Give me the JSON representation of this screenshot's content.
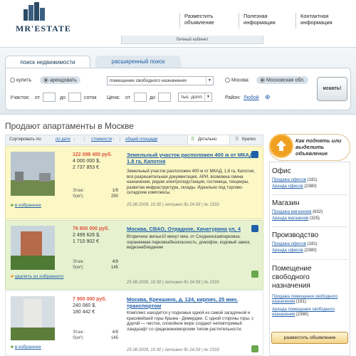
{
  "header": {
    "logo_text": "MR'ESTATE",
    "links": [
      {
        "label": "Разместить объявление"
      },
      {
        "label": "Полезная информация"
      },
      {
        "label": "Контактная информация"
      }
    ],
    "cabinet": "Личный кабинет"
  },
  "search": {
    "tab_basic": "поиск недвижимости",
    "tab_advanced": "расширенный поиск",
    "buy": "купить",
    "rent": "арендовать",
    "type_value": "помещение свободного назначения",
    "city_moscow": "Москва",
    "city_region": "Московская обл.",
    "area_label": "Участок:",
    "from1": "от",
    "to1": "до",
    "unit_area": "соток",
    "price_label": "Цена:",
    "from2": "от",
    "to2": "до",
    "currency_value": "тыс. долл.",
    "district_label": "Район:",
    "district_value": "Любой",
    "search_button": "искать!"
  },
  "heading": "Продают апартаменты в Москве",
  "sortbar": {
    "label": "Сортировать по:",
    "by_date": "по дате",
    "by_cost": "стоимости",
    "by_area": "общей площади",
    "view_detail": "Детально",
    "view_short": "Кратко"
  },
  "listings": [
    {
      "price_rub": "122 098 400 руб.",
      "price_usd": "4 000 000 $,",
      "price_eur": "2 737 853 €",
      "title": "Земельный участок расположен 400 м от МКАД, 1.8 га, Капотня",
      "desc": "Земельный участок расположен 400 м от МКАД, 1.8 га, Капотня, вся разрешительная документация, АРИ, возможна смена назначения, рядом электроподстанция, гостиница, техценры, развитая инфраструктура, склады. Идеально под торгово-складские комплексы.",
      "floor_label": "Этаж:",
      "floor": "1/9",
      "area_label": "S(м²):",
      "area": "250",
      "fav": "в избранное",
      "date": "25.08.2009, 10:30  |  Активно до 24.09  |  № 2333"
    },
    {
      "price_rub": "76 800 000 руб.",
      "price_usd": "2 499 626 $,",
      "price_eur": "1 710 902 €",
      "title": "Москва, СВАО, Отрадное, Хачатуряна ул, 4",
      "desc": "Вторичное жилье10 минут мин.  от  Сходненскаяпарковка: охраняемая парковкабезопасность: домофон, кодовый замок, видеонаблюдение",
      "floor_label": "Этаж:",
      "floor": "4/9",
      "area_label": "S(м²):",
      "area": "145",
      "fav": "удалить из избранного",
      "date": "25.08.2009, 10:30  |  Активно до 24.09  |  № 2333"
    },
    {
      "price_rub": "7 900 000 руб.",
      "price_usd": "240 060 $,",
      "price_eur": "180 442 €",
      "title": "Москва, Крекшино, д. 124, кирпич, 25 мин. транспортом",
      "desc": "Комплекс находится у подножья одной из самой загадочной и красивейшей горы Крыма - Демерджи. С одной стороны горы, с другой — чистое, спокойное море создают неповторимый ландшафт со средиземноморским типом растительности.",
      "floor_label": "Этаж:",
      "floor": "4/9",
      "area_label": "S(м²):",
      "area": "145",
      "fav": "в избранное",
      "date": "25.08.2009, 10:30  |  Активно до 24.09  |  № 2333"
    }
  ],
  "promo": "Как поднять или выделить объявление",
  "sidebar": {
    "office": {
      "title": "Офис",
      "links": [
        {
          "label": "Продажа офисов",
          "count": "(181)"
        },
        {
          "label": "Аренда офисов",
          "count": "(2380)"
        }
      ]
    },
    "shop": {
      "title": "Магазин",
      "links": [
        {
          "label": "Продажа магазинов",
          "count": "(632)"
        },
        {
          "label": "Аренда магазинов",
          "count": "(325)"
        }
      ]
    },
    "prod": {
      "title": "Производство",
      "links": [
        {
          "label": "Продажа офисов",
          "count": "(181)"
        },
        {
          "label": "Аренда офисов",
          "count": "(2380)"
        }
      ]
    },
    "free": {
      "title": "Помещение свободного назначения",
      "links": [
        {
          "label": "Продажа помещения свободного назначения",
          "count": "(181)"
        },
        {
          "label": "Аренда помещения свободного назначения",
          "count": "(2380)"
        }
      ]
    },
    "place_button": "разместить объявление"
  },
  "colors": {
    "accent_blue": "#1f5fa8",
    "price_red": "#e2533f",
    "highlight_yellow": "#fbf8c6",
    "highlight_green": "#e6f2cf"
  }
}
